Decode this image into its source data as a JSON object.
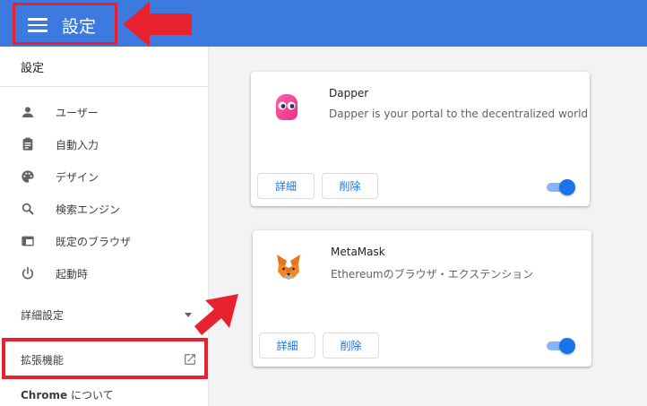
{
  "header": {
    "title": "設定",
    "menu_icon": "hamburger-icon"
  },
  "sidebar": {
    "header": "設定",
    "items": [
      {
        "label": "ユーザー",
        "icon": "person-icon"
      },
      {
        "label": "自動入力",
        "icon": "clipboard-icon"
      },
      {
        "label": "デザイン",
        "icon": "palette-icon"
      },
      {
        "label": "検索エンジン",
        "icon": "search-icon"
      },
      {
        "label": "既定のブラウザ",
        "icon": "browser-icon"
      },
      {
        "label": "起動時",
        "icon": "power-icon"
      }
    ],
    "advanced_label": "詳細設定",
    "extensions_label": "拡張機能",
    "about_brand": "Chrome",
    "about_suffix": " について"
  },
  "extensions": [
    {
      "name": "Dapper",
      "description": "Dapper is your portal to the decentralized world",
      "detail_label": "詳細",
      "remove_label": "削除",
      "enabled": true
    },
    {
      "name": "MetaMask",
      "description": "Ethereumのブラウザ・エクステンション",
      "detail_label": "詳細",
      "remove_label": "削除",
      "enabled": true
    }
  ],
  "colors": {
    "topbar": "#3c7ae0",
    "accent": "#1a73e8",
    "highlight": "#e8212e"
  }
}
